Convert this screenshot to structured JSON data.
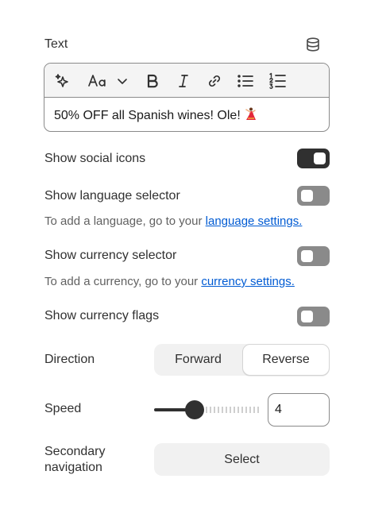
{
  "text_section": {
    "label": "Text",
    "dynamic_source_icon": "database-icon",
    "toolbar": {
      "buttons": [
        "sparkle-icon",
        "font-size-icon",
        "chevron-down-icon",
        "bold-icon",
        "italic-icon",
        "link-icon",
        "bullet-list-icon",
        "numbered-list-icon"
      ]
    },
    "content": "50% OFF all Spanish wines! Ole!",
    "content_emoji": "dancer-emoji"
  },
  "settings": {
    "social_icons": {
      "label": "Show social icons",
      "enabled": true
    },
    "language_selector": {
      "label": "Show language selector",
      "enabled": false,
      "help_prefix": "To add a language, go to your ",
      "help_link": "language settings."
    },
    "currency_selector": {
      "label": "Show currency selector",
      "enabled": false,
      "help_prefix": "To add a currency, go to your ",
      "help_link": "currency settings."
    },
    "currency_flags": {
      "label": "Show currency flags",
      "enabled": false
    }
  },
  "direction": {
    "label": "Direction",
    "options": [
      "Forward",
      "Reverse"
    ],
    "selected": "Reverse"
  },
  "speed": {
    "label": "Speed",
    "value": "4",
    "slider_fraction": 0.35
  },
  "secondary_navigation": {
    "label": "Secondary navigation",
    "button_label": "Select"
  },
  "colors": {
    "text": "#303030",
    "toggle_on": "#303030",
    "toggle_off": "#8a8a8a",
    "link": "#005bd3"
  }
}
